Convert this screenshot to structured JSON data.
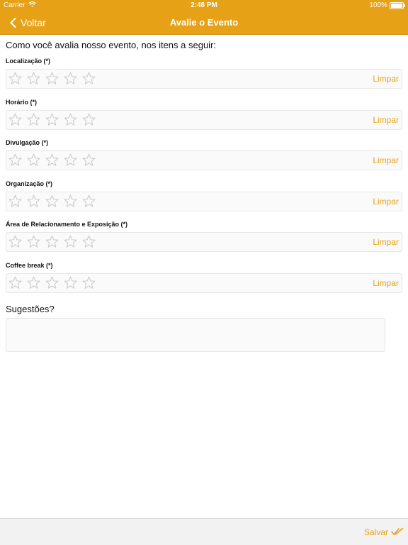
{
  "status_bar": {
    "carrier": "Carrier",
    "time": "2:48 PM",
    "battery": "100%"
  },
  "nav": {
    "back_label": "Voltar",
    "title": "Avalie o Evento"
  },
  "intro": "Como você avalia nosso evento, nos itens a seguir:",
  "ratings": [
    {
      "label": "Localização (*)",
      "stars_total": 5,
      "stars_selected": 0,
      "clear_label": "Limpar"
    },
    {
      "label": "Horário (*)",
      "stars_total": 5,
      "stars_selected": 0,
      "clear_label": "Limpar"
    },
    {
      "label": "Divulgação  (*)",
      "stars_total": 5,
      "stars_selected": 0,
      "clear_label": "Limpar"
    },
    {
      "label": "Organização (*)",
      "stars_total": 5,
      "stars_selected": 0,
      "clear_label": "Limpar"
    },
    {
      "label": "Área de Relacionamento e Exposição (*)",
      "stars_total": 5,
      "stars_selected": 0,
      "clear_label": "Limpar"
    },
    {
      "label": "Coffee break (*)",
      "stars_total": 5,
      "stars_selected": 0,
      "clear_label": "Limpar"
    }
  ],
  "suggestions": {
    "label": "Sugestões?",
    "value": "",
    "placeholder": ""
  },
  "toolbar": {
    "save_label": "Salvar",
    "save_icon": "double-check-icon"
  },
  "colors": {
    "accent": "#e6a117",
    "star_outline": "#c8c8c8"
  }
}
